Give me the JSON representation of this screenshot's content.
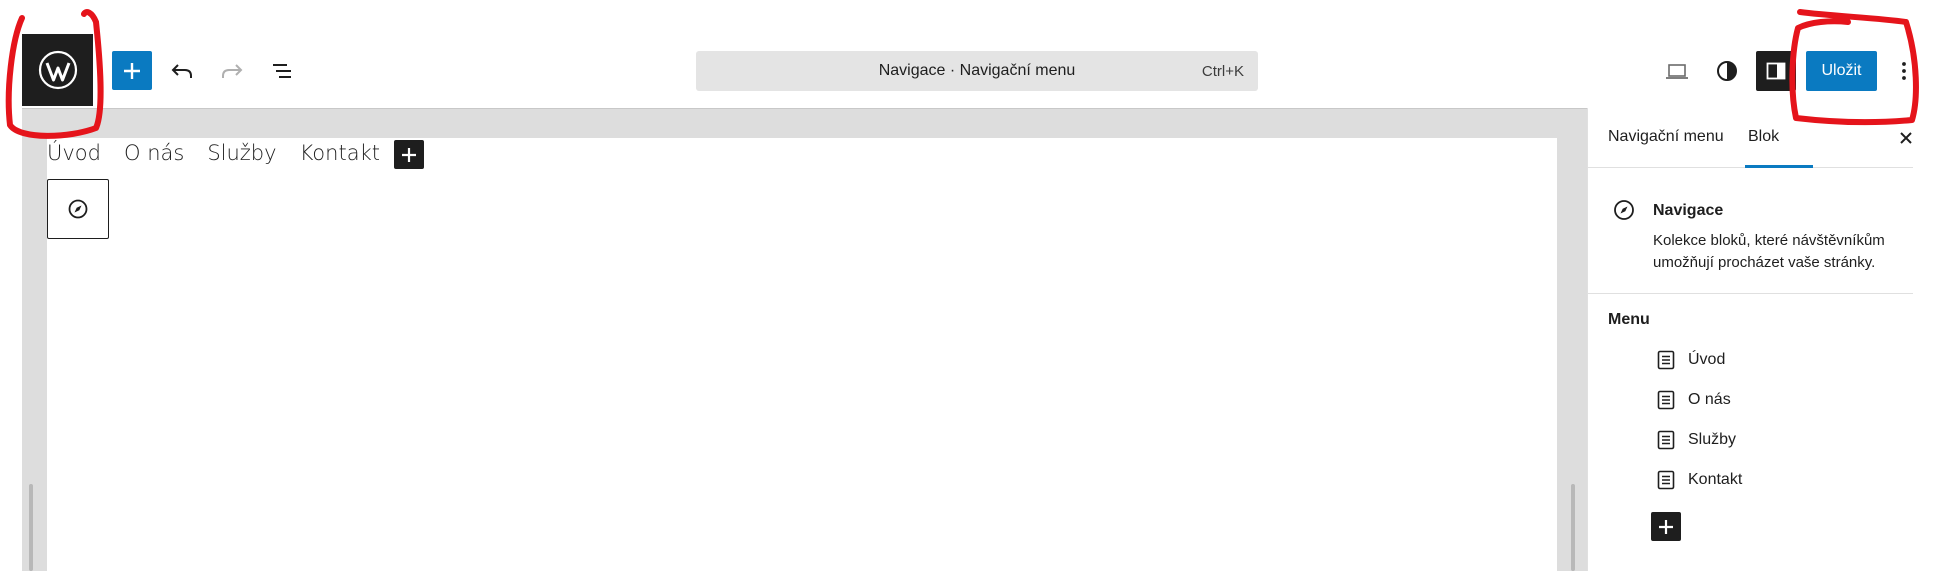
{
  "toolbar": {
    "document_title": "Navigace · Navigační menu",
    "shortcut": "Ctrl+K",
    "save_label": "Uložit"
  },
  "canvas": {
    "nav_items": [
      "Úvod",
      "O nás",
      "Služby",
      "Kontakt"
    ]
  },
  "sidebar": {
    "tabs": [
      {
        "label": "Navigační menu",
        "active": false
      },
      {
        "label": "Blok",
        "active": true
      }
    ],
    "block": {
      "title": "Navigace",
      "description": "Kolekce bloků, které návštěvníkům umožňují procházet vaše stránky.",
      "icon": "compass-icon"
    },
    "menu_heading": "Menu",
    "menu_items": [
      {
        "label": "Úvod",
        "icon": "page-icon"
      },
      {
        "label": "O nás",
        "icon": "page-icon"
      },
      {
        "label": "Služby",
        "icon": "page-icon"
      },
      {
        "label": "Kontakt",
        "icon": "page-icon"
      }
    ]
  },
  "colors": {
    "accent": "#0a7ac1",
    "dark": "#1e1e1e",
    "annotation": "#e5141b"
  }
}
